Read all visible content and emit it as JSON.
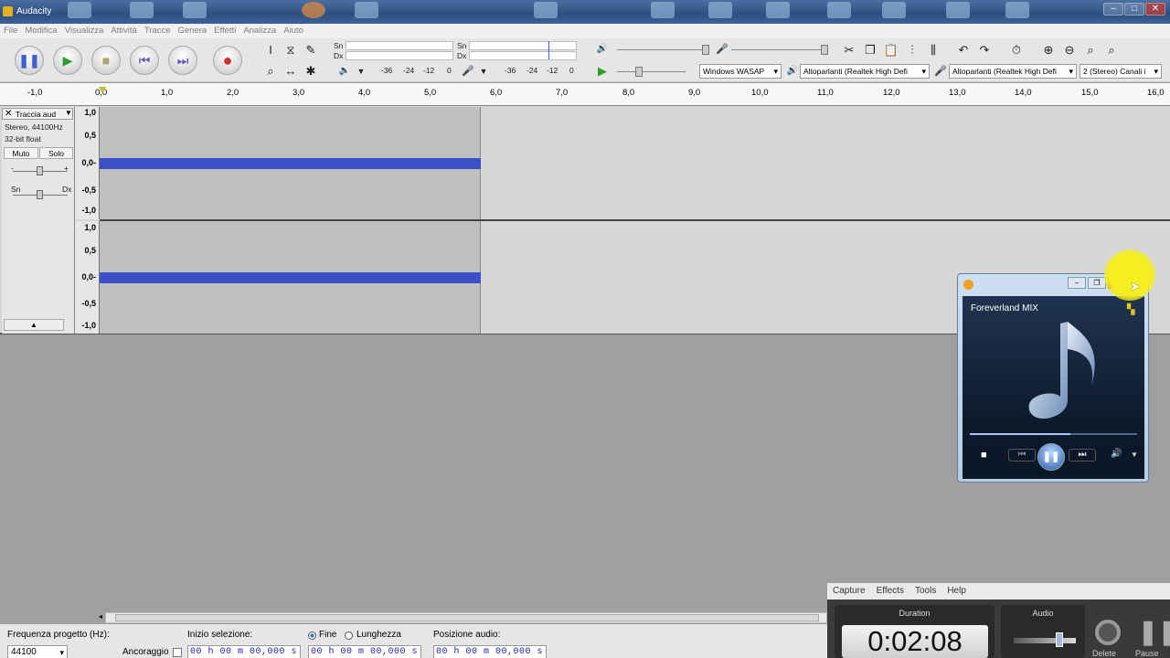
{
  "window": {
    "title": "Audacity"
  },
  "menu": [
    "File",
    "Modifica",
    "Visualizza",
    "Attività",
    "Tracce",
    "Genera",
    "Effetti",
    "Analizza",
    "Aiuto"
  ],
  "meters": {
    "playback_left": "Sn",
    "playback_right": "Dx",
    "record_left": "Sn",
    "record_right": "Dx",
    "scale_playback": [
      "-36",
      "-24",
      "-12",
      "0"
    ],
    "scale_record": [
      "-36",
      "-24",
      "-12",
      "0"
    ]
  },
  "device": {
    "host": "Windows WASAP",
    "output": "Altoparlanti (Realtek High Defi",
    "input": "Altoparlanti (Realtek High Defi",
    "channels": "2 (Stereo) Canali i"
  },
  "ruler": [
    "-1,0",
    "0,0",
    "1,0",
    "2,0",
    "3,0",
    "4,0",
    "5,0",
    "6,0",
    "7,0",
    "8,0",
    "9,0",
    "10,0",
    "11,0",
    "12,0",
    "13,0",
    "14,0",
    "15,0",
    "16,0"
  ],
  "track": {
    "name": "Traccia aud",
    "info1": "Stereo, 44100Hz",
    "info2": "32-bit float",
    "mute": "Muto",
    "solo": "Solo",
    "pan_left": "Sn",
    "pan_right": "Dx",
    "gain_minus": "-",
    "gain_plus": "+",
    "scale": [
      "1,0",
      "0,5",
      "0,0-",
      "-0,5",
      "-1,0"
    ]
  },
  "status": {
    "rate_label": "Frequenza progetto (Hz):",
    "rate_value": "44100",
    "snap_label": "Ancoraggio",
    "sel_start_label": "Inizio selezione:",
    "end_label": "Fine",
    "length_label": "Lunghezza",
    "audio_pos_label": "Posizione audio:",
    "time1": "00 h 00 m 00,000 s",
    "time2": "00 h 00 m 00,000 s",
    "time3": "00 h 00 m 00,000 s"
  },
  "wmp": {
    "title": "Foreverland MIX"
  },
  "recorder": {
    "menu": [
      "Capture",
      "Effects",
      "Tools",
      "Help"
    ],
    "duration_label": "Duration",
    "duration": "0:02:08",
    "audio_label": "Audio",
    "delete": "Delete",
    "pause": "Pause"
  },
  "colors": {
    "waveform": "#3b4fc8",
    "record": "#d03030",
    "play": "#2aa02a",
    "highlight": "#f4e41a"
  }
}
